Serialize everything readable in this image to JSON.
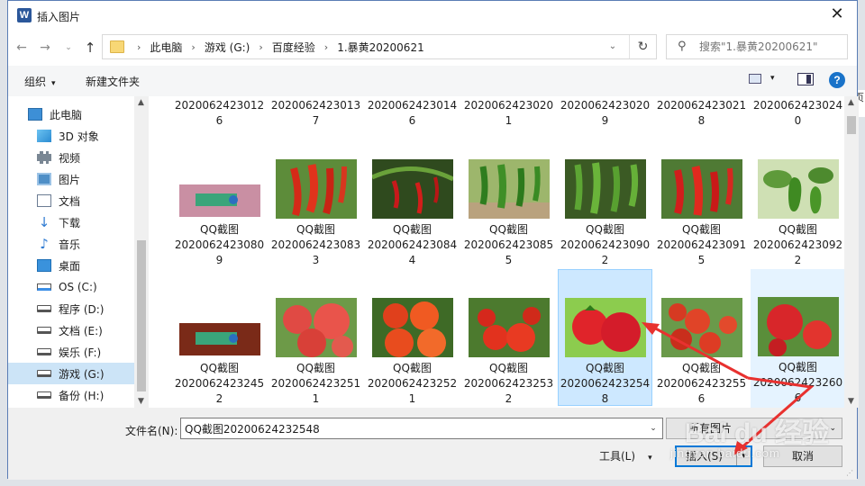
{
  "window": {
    "title": "插入图片",
    "app_icon": "word-icon",
    "close_glyph": "✕"
  },
  "nav": {
    "back_glyph": "←",
    "forward_glyph": "→",
    "recent_glyph": "⌄",
    "up_glyph": "↑"
  },
  "address": {
    "crumbs": [
      "此电脑",
      "游戏 (G:)",
      "百度经验",
      "1.暴黄20200621"
    ],
    "separator": "›",
    "dropdown_glyph": "⌄",
    "refresh_glyph": "↻"
  },
  "search": {
    "placeholder": "搜索\"1.暴黄20200621\"",
    "icon": "search-icon"
  },
  "toolbar": {
    "organize": "组织",
    "organize_caret": "▾",
    "new_folder": "新建文件夹",
    "view_caret": "▾",
    "help": "?"
  },
  "sidebar": {
    "items": [
      {
        "label": "此电脑",
        "icon": "computer-icon"
      },
      {
        "label": "3D 对象",
        "icon": "3d-objects-icon"
      },
      {
        "label": "视频",
        "icon": "video-icon"
      },
      {
        "label": "图片",
        "icon": "pictures-icon"
      },
      {
        "label": "文档",
        "icon": "documents-icon"
      },
      {
        "label": "下载",
        "icon": "download-icon"
      },
      {
        "label": "音乐",
        "icon": "music-icon"
      },
      {
        "label": "桌面",
        "icon": "desktop-icon"
      },
      {
        "label": "OS (C:)",
        "icon": "os-drive-icon"
      },
      {
        "label": "程序 (D:)",
        "icon": "drive-icon"
      },
      {
        "label": "文档 (E:)",
        "icon": "drive-icon"
      },
      {
        "label": "娱乐 (F:)",
        "icon": "drive-icon"
      },
      {
        "label": "游戏 (G:)",
        "icon": "drive-icon",
        "selected": true
      },
      {
        "label": "备份 (H:)",
        "icon": "drive-icon"
      }
    ]
  },
  "files": {
    "row1": [
      {
        "line1": "2020062423012",
        "line2": "6"
      },
      {
        "line1": "2020062423013",
        "line2": "7"
      },
      {
        "line1": "2020062423014",
        "line2": "6"
      },
      {
        "line1": "2020062423020",
        "line2": "1"
      },
      {
        "line1": "2020062423020",
        "line2": "9"
      },
      {
        "line1": "2020062423021",
        "line2": "8"
      },
      {
        "line1": "2020062423024",
        "line2": "0"
      }
    ],
    "row2": [
      {
        "name": "QQ截图",
        "line1": "2020062423080",
        "line2": "9",
        "thumb": "banner"
      },
      {
        "name": "QQ截图",
        "line1": "2020062423083",
        "line2": "3",
        "thumb": "red-pepper"
      },
      {
        "name": "QQ截图",
        "line1": "2020062423084",
        "line2": "4",
        "thumb": "red-pepper-dark"
      },
      {
        "name": "QQ截图",
        "line1": "2020062423085",
        "line2": "5",
        "thumb": "green-pepper"
      },
      {
        "name": "QQ截图",
        "line1": "2020062423090",
        "line2": "2",
        "thumb": "green-pepper"
      },
      {
        "name": "QQ截图",
        "line1": "2020062423091",
        "line2": "5",
        "thumb": "red-pepper"
      },
      {
        "name": "QQ截图",
        "line1": "2020062423092",
        "line2": "2",
        "thumb": "green-pepper-leaf"
      }
    ],
    "row3": [
      {
        "name": "QQ截图",
        "line1": "2020062423245",
        "line2": "2",
        "thumb": "banner-dark"
      },
      {
        "name": "QQ截图",
        "line1": "2020062423251",
        "line2": "1",
        "thumb": "tomato"
      },
      {
        "name": "QQ截图",
        "line1": "2020062423252",
        "line2": "1",
        "thumb": "tomato"
      },
      {
        "name": "QQ截图",
        "line1": "2020062423253",
        "line2": "2",
        "thumb": "tomato"
      },
      {
        "name": "QQ截图",
        "line1": "2020062423254",
        "line2": "8",
        "thumb": "tomato",
        "selected": true
      },
      {
        "name": "QQ截图",
        "line1": "2020062423255",
        "line2": "6",
        "thumb": "tomato"
      },
      {
        "name": "QQ截图",
        "line1": "2020062423260",
        "line2": "6",
        "thumb": "tomato",
        "hover": true
      }
    ]
  },
  "bottom": {
    "filename_label": "文件名(N):",
    "filename_value": "QQ截图20200624232548",
    "filetype_value": "所有图片",
    "tools": "工具(L)",
    "insert": "插入(S)",
    "cancel": "取消"
  },
  "watermark": {
    "main": "Bai du 经验",
    "sub": "jingyan.baidu.com"
  },
  "bg_text": "页",
  "colors": {
    "selection_bg": "#cde8ff",
    "selection_border": "#99d1ff",
    "accent": "#0078d7",
    "annotation_arrow": "#e8312f"
  }
}
